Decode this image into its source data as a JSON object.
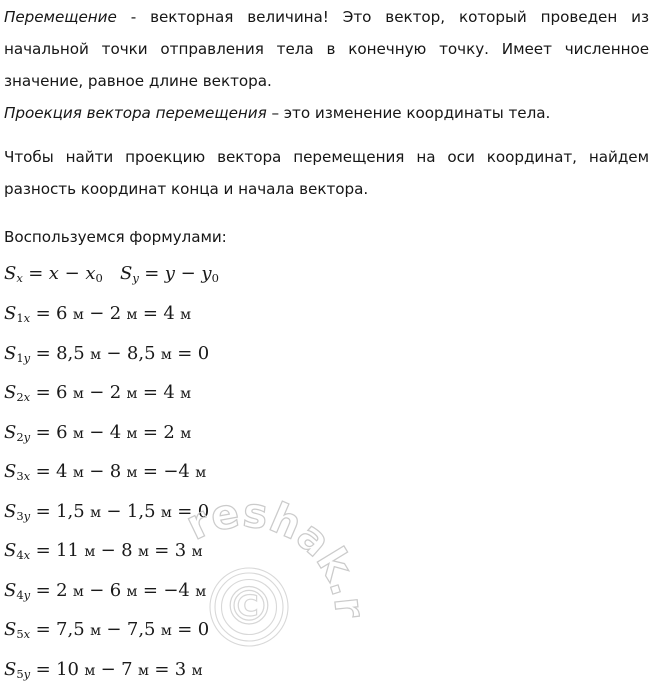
{
  "document": {
    "language": "ru",
    "background_color": "#ffffff",
    "text_color": "#161616",
    "paragraphs": {
      "definition": {
        "term": "Перемещение",
        "rest": " - векторная величина! Это вектор, который проведен из начальной точки отправления тела в конечную точку. Имеет численное значение, равное длине вектора."
      },
      "projection": {
        "term": "Проекция вектора перемещения",
        "rest": " – это изменение координаты тела."
      },
      "howto": "Чтобы найти проекцию вектора перемещения на оси координат, найдем разность координат конца и начала вектора.",
      "use_formulas": "Воспользуемся формулами:"
    },
    "general_formulas": {
      "sx": {
        "lhs_base": "S",
        "lhs_sub": "x",
        "rhs": "x − x",
        "rhs_sub": "0"
      },
      "sy": {
        "lhs_base": "S",
        "lhs_sub": "y",
        "rhs": "y − y",
        "rhs_sub": "0"
      }
    },
    "unit": "м",
    "equals": "=",
    "minus": "−",
    "computations": [
      {
        "base": "S",
        "index": "1",
        "axis": "x",
        "a": "6",
        "b": "2",
        "result": "4"
      },
      {
        "base": "S",
        "index": "1",
        "axis": "y",
        "a": "8,5",
        "b": "8,5",
        "result": "0",
        "result_unitless": true
      },
      {
        "base": "S",
        "index": "2",
        "axis": "x",
        "a": "6",
        "b": "2",
        "result": "4"
      },
      {
        "base": "S",
        "index": "2",
        "axis": "y",
        "a": "6",
        "b": "4",
        "result": "2"
      },
      {
        "base": "S",
        "index": "3",
        "axis": "x",
        "a": "4",
        "b": "8",
        "result": "−4"
      },
      {
        "base": "S",
        "index": "3",
        "axis": "y",
        "a": "1,5",
        "b": "1,5",
        "result": "0",
        "result_unitless": true
      },
      {
        "base": "S",
        "index": "4",
        "axis": "x",
        "a": "11",
        "b": "8",
        "result": "3"
      },
      {
        "base": "S",
        "index": "4",
        "axis": "y",
        "a": "2",
        "b": "6",
        "result": "−4"
      },
      {
        "base": "S",
        "index": "5",
        "axis": "x",
        "a": "7,5",
        "b": "7,5",
        "result": "0",
        "result_unitless": true
      },
      {
        "base": "S",
        "index": "5",
        "axis": "y",
        "a": "10",
        "b": "7",
        "result": "3"
      }
    ],
    "watermark": {
      "text": "reshak.ru",
      "copyright_symbol": "©",
      "style": "outline",
      "stroke_color": "#cfcfcf"
    }
  }
}
